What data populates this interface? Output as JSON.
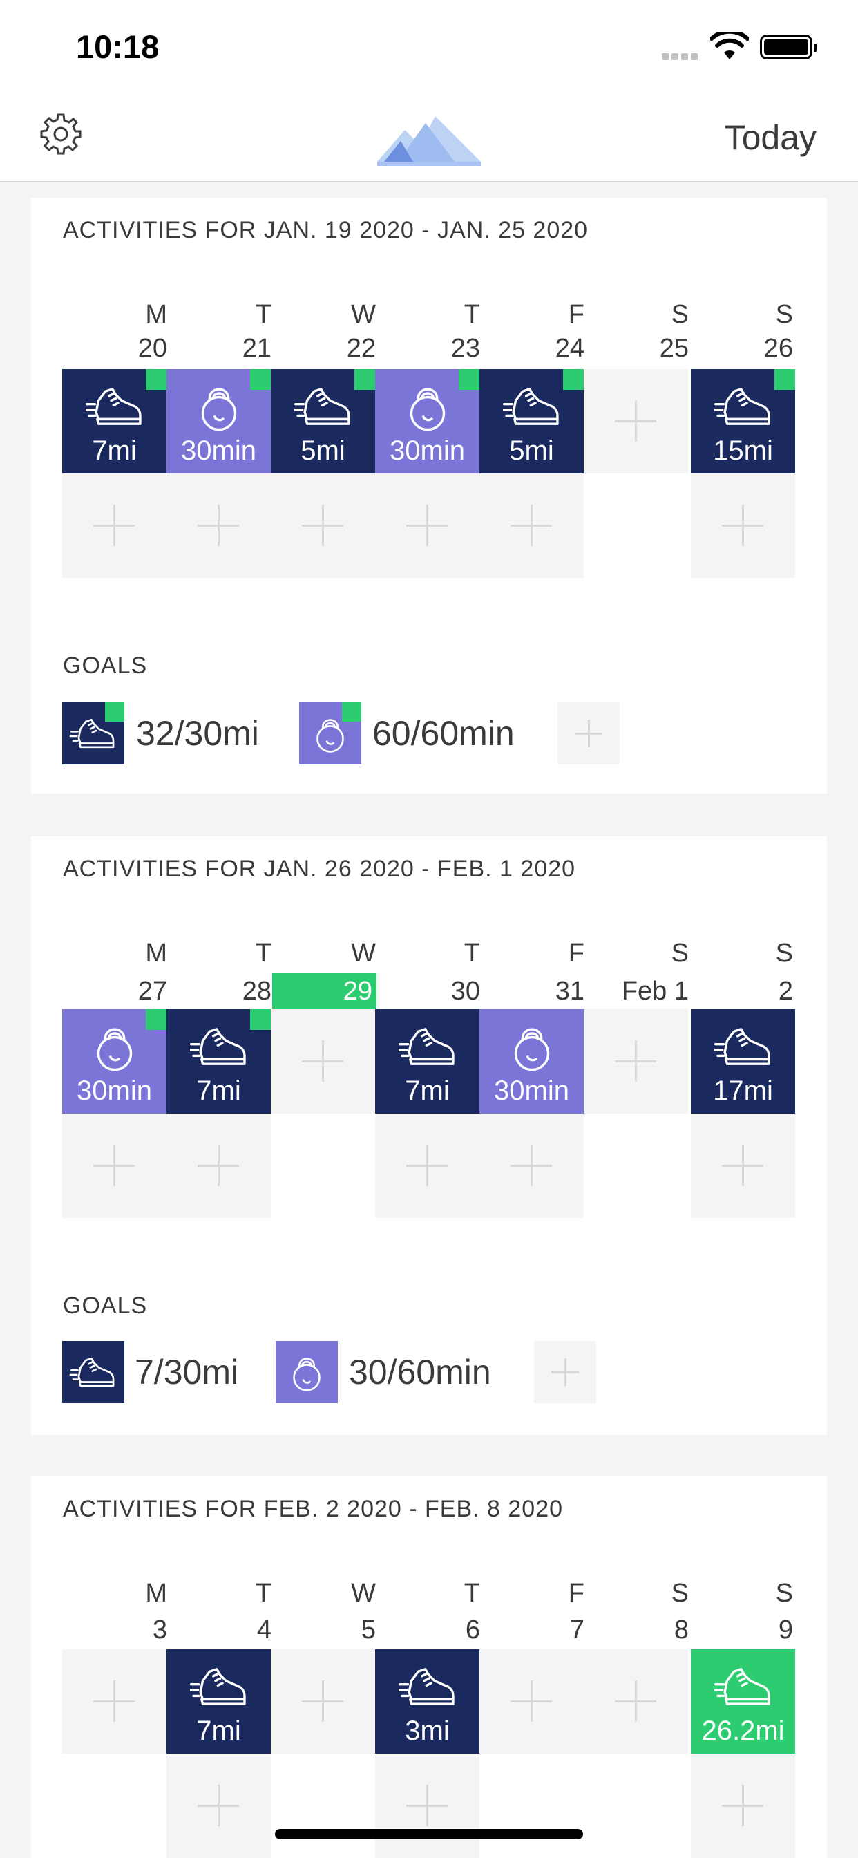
{
  "status": {
    "time": "10:18"
  },
  "nav": {
    "settings_icon": "gear-icon",
    "logo_icon": "mountain-logo-icon",
    "today_label": "Today"
  },
  "colors": {
    "run": "#1b2a5e",
    "kettlebell": "#7b75d8",
    "goal_met": "#2ecc71",
    "empty": "#f4f4f4"
  },
  "weeks": [
    {
      "title": "ACTIVITIES FOR JAN. 19 2020 - JAN. 25 2020",
      "days": [
        {
          "dow": "M",
          "num": "20"
        },
        {
          "dow": "T",
          "num": "21"
        },
        {
          "dow": "W",
          "num": "22"
        },
        {
          "dow": "T",
          "num": "23"
        },
        {
          "dow": "F",
          "num": "24"
        },
        {
          "dow": "S",
          "num": "25"
        },
        {
          "dow": "S",
          "num": "26"
        }
      ],
      "activities": [
        {
          "label": "7mi",
          "icon": "running-shoe-icon"
        },
        {
          "label": "30min",
          "icon": "kettlebell-icon"
        },
        {
          "label": "5mi",
          "icon": "running-shoe-icon"
        },
        {
          "label": "30min",
          "icon": "kettlebell-icon"
        },
        {
          "label": "5mi",
          "icon": "running-shoe-icon"
        },
        {
          "label": "15mi",
          "icon": "running-shoe-icon"
        }
      ],
      "goals_title": "GOALS",
      "goals": [
        {
          "text": "32/30mi",
          "icon": "running-shoe-icon"
        },
        {
          "text": "60/60min",
          "icon": "kettlebell-icon"
        }
      ]
    },
    {
      "title": "ACTIVITIES FOR JAN. 26 2020 - FEB. 1 2020",
      "days": [
        {
          "dow": "M",
          "num": "27"
        },
        {
          "dow": "T",
          "num": "28"
        },
        {
          "dow": "W",
          "num": "29"
        },
        {
          "dow": "T",
          "num": "30"
        },
        {
          "dow": "F",
          "num": "31"
        },
        {
          "dow": "S",
          "num": "Feb 1"
        },
        {
          "dow": "S",
          "num": "2"
        }
      ],
      "activities": [
        {
          "label": "30min",
          "icon": "kettlebell-icon"
        },
        {
          "label": "7mi",
          "icon": "running-shoe-icon"
        },
        {
          "label": "7mi",
          "icon": "running-shoe-icon"
        },
        {
          "label": "30min",
          "icon": "kettlebell-icon"
        },
        {
          "label": "17mi",
          "icon": "running-shoe-icon"
        }
      ],
      "goals_title": "GOALS",
      "goals": [
        {
          "text": "7/30mi",
          "icon": "running-shoe-icon"
        },
        {
          "text": "30/60min",
          "icon": "kettlebell-icon"
        }
      ]
    },
    {
      "title": "ACTIVITIES FOR FEB. 2 2020 - FEB. 8 2020",
      "days": [
        {
          "dow": "M",
          "num": "3"
        },
        {
          "dow": "T",
          "num": "4"
        },
        {
          "dow": "W",
          "num": "5"
        },
        {
          "dow": "T",
          "num": "6"
        },
        {
          "dow": "F",
          "num": "7"
        },
        {
          "dow": "S",
          "num": "8"
        },
        {
          "dow": "S",
          "num": "9"
        }
      ],
      "activities": [
        {
          "label": "7mi",
          "icon": "running-shoe-icon"
        },
        {
          "label": "3mi",
          "icon": "running-shoe-icon"
        },
        {
          "label": "26.2mi",
          "icon": "running-shoe-icon"
        }
      ]
    }
  ]
}
